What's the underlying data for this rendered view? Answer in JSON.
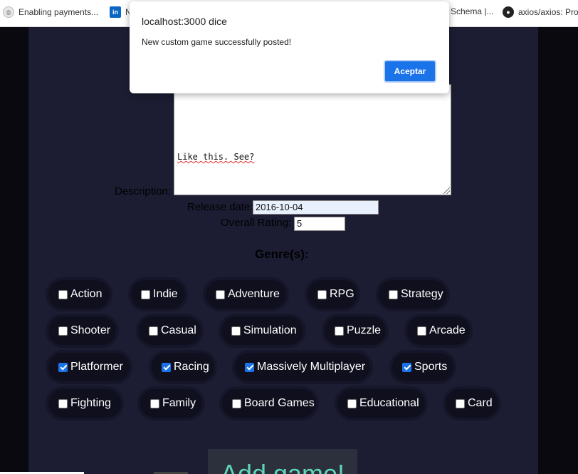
{
  "bookmarks": [
    {
      "label": "Enabling payments...",
      "icon": "globe-icon"
    },
    {
      "label": "N",
      "icon": "linkedin-icon"
    },
    {
      "label": "Schema |...",
      "icon": ""
    },
    {
      "label": "axios/axios: Pro",
      "icon": "github-icon"
    }
  ],
  "form": {
    "description_label": "Description:",
    "description_value": "Like this. See?",
    "release_label": "Release date:",
    "release_value": "2016-10-04",
    "rating_label": "Overall Rating:",
    "rating_value": "5",
    "genre_title": "Genre(s):"
  },
  "genres": [
    {
      "label": "Action",
      "checked": false
    },
    {
      "label": "Indie",
      "checked": false
    },
    {
      "label": "Adventure",
      "checked": false
    },
    {
      "label": "RPG",
      "checked": false
    },
    {
      "label": "Strategy",
      "checked": false
    },
    {
      "label": "Shooter",
      "checked": false
    },
    {
      "label": "Casual",
      "checked": false
    },
    {
      "label": "Simulation",
      "checked": false
    },
    {
      "label": "Puzzle",
      "checked": false
    },
    {
      "label": "Arcade",
      "checked": false
    },
    {
      "label": "Platformer",
      "checked": true
    },
    {
      "label": "Racing",
      "checked": true
    },
    {
      "label": "Massively Multiplayer",
      "checked": true
    },
    {
      "label": "Sports",
      "checked": true
    },
    {
      "label": "Fighting",
      "checked": false
    },
    {
      "label": "Family",
      "checked": false
    },
    {
      "label": "Board Games",
      "checked": false
    },
    {
      "label": "Educational",
      "checked": false
    },
    {
      "label": "Card",
      "checked": false
    }
  ],
  "add_button": "Add game!",
  "dialog": {
    "title": "localhost:3000 dice",
    "message": "New custom game successfully posted!",
    "ok_label": "Aceptar"
  },
  "colors": {
    "panel_bg": "#1c1d32",
    "page_bg": "#0d0d14",
    "accent_blue": "#1a73e8",
    "add_button_text": "#5fd6b6"
  }
}
